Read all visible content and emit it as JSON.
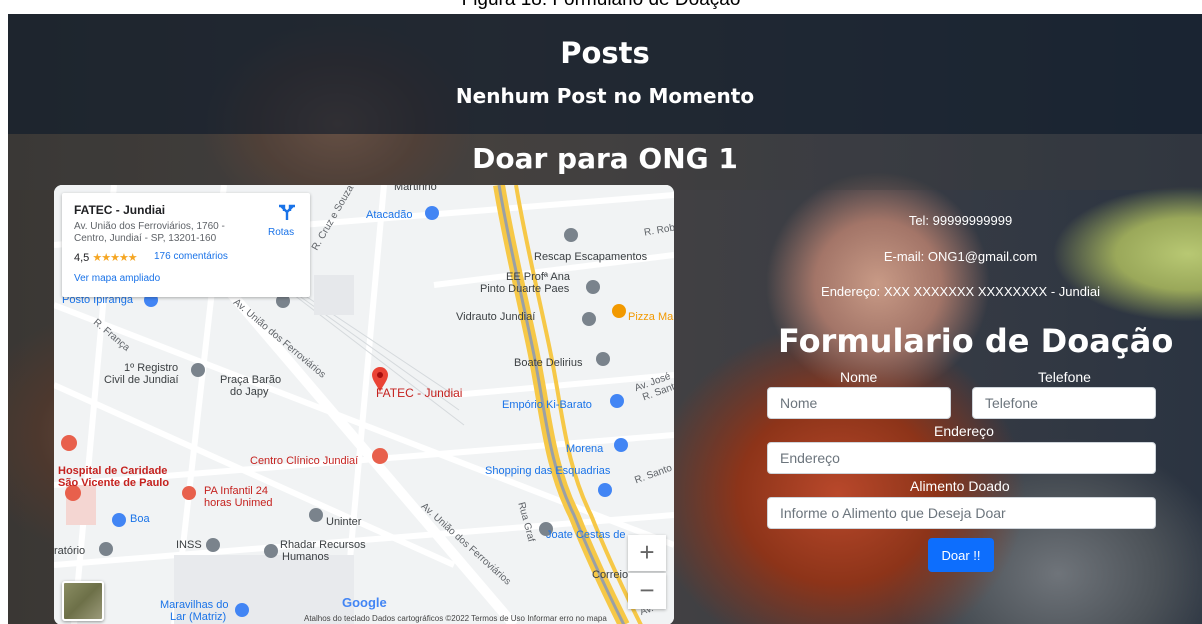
{
  "caption": "Figura 18: Formulario de Doação",
  "header": {
    "title": "Posts",
    "subtitle": "Nenhum Post no Momento"
  },
  "ong": {
    "title": "Doar para ONG 1"
  },
  "map": {
    "card": {
      "title": "FATEC - Jundiai",
      "address": "Av. União dos Ferroviários, 1760 - Centro, Jundiaí - SP, 13201-160",
      "rating": "4,5",
      "stars": "★★★★★",
      "reviews": "176 comentários",
      "larger_map": "Ver mapa ampliado",
      "directions": "Rotas"
    },
    "labels": {
      "atacadao": "Atacadão",
      "rescap": "Rescap Escapamentos",
      "ee": "EE Profª Ana",
      "ee2": "Pinto Duarte Paes",
      "vidrauto": "Vidrauto Jundiaí",
      "pizza": "Pizza Ma",
      "boate": "Boate Delirius",
      "emporio": "Empório Ki-Barato",
      "morena": "Morena",
      "shopping": "Shopping das Esquadrias",
      "joate": "Joate Cestas de",
      "correio": "Correio",
      "posto": "Posto Ipiranga",
      "registro1": "1º Registro",
      "registro2": "Civil de Jundiaí",
      "praca1": "Praça Barão",
      "praca2": "do Japy",
      "fatec": "FATEC - Jundiai",
      "centro": "Centro Clínico Jundiaí",
      "hospital1": "Hospital de Caridade",
      "hospital2": "São Vicente de Paulo",
      "pa1": "PA Infantil 24",
      "pa2": "horas Unimed",
      "boa": "Boa",
      "uninter": "Uninter",
      "inss": "INSS",
      "rhadar1": "Rhadar Recursos",
      "rhadar2": "Humanos",
      "maravilhas1": "Maravilhas do",
      "maravilhas2": "Lar (Matriz)",
      "ratorio": "ratório",
      "martinho": "Martinho",
      "road_cruz": "R. Cruz e Souza",
      "road_franca": "R. França",
      "road_uniao1": "Av. União dos Ferroviários",
      "road_uniao2": "Av. União dos Ferroviários",
      "road_rob": "R. Rob",
      "road_jose": "Av. José",
      "road_sant": "R. Sant",
      "road_santo": "R. Santo",
      "road_graf": "Rua Graf",
      "road_av": "Av."
    },
    "zoom_in": "+",
    "zoom_out": "−",
    "google": "Google",
    "attribution": "Atalhos do teclado   Dados cartográficos ©2022   Termos de Uso   Informar erro no mapa"
  },
  "contact": {
    "tel": "Tel: 99999999999",
    "email": "E-mail: ONG1@gmail.com",
    "address": "Endereço: XXX XXXXXXX XXXXXXXX - Jundiai"
  },
  "form": {
    "title": "Formulario de Doação",
    "nome_label": "Nome",
    "nome_placeholder": "Nome",
    "telefone_label": "Telefone",
    "telefone_placeholder": "Telefone",
    "endereco_label": "Endereço",
    "endereco_placeholder": "Endereço",
    "alimento_label": "Alimento Doado",
    "alimento_placeholder": "Informe o Alimento que Deseja Doar",
    "submit": "Doar !!"
  }
}
